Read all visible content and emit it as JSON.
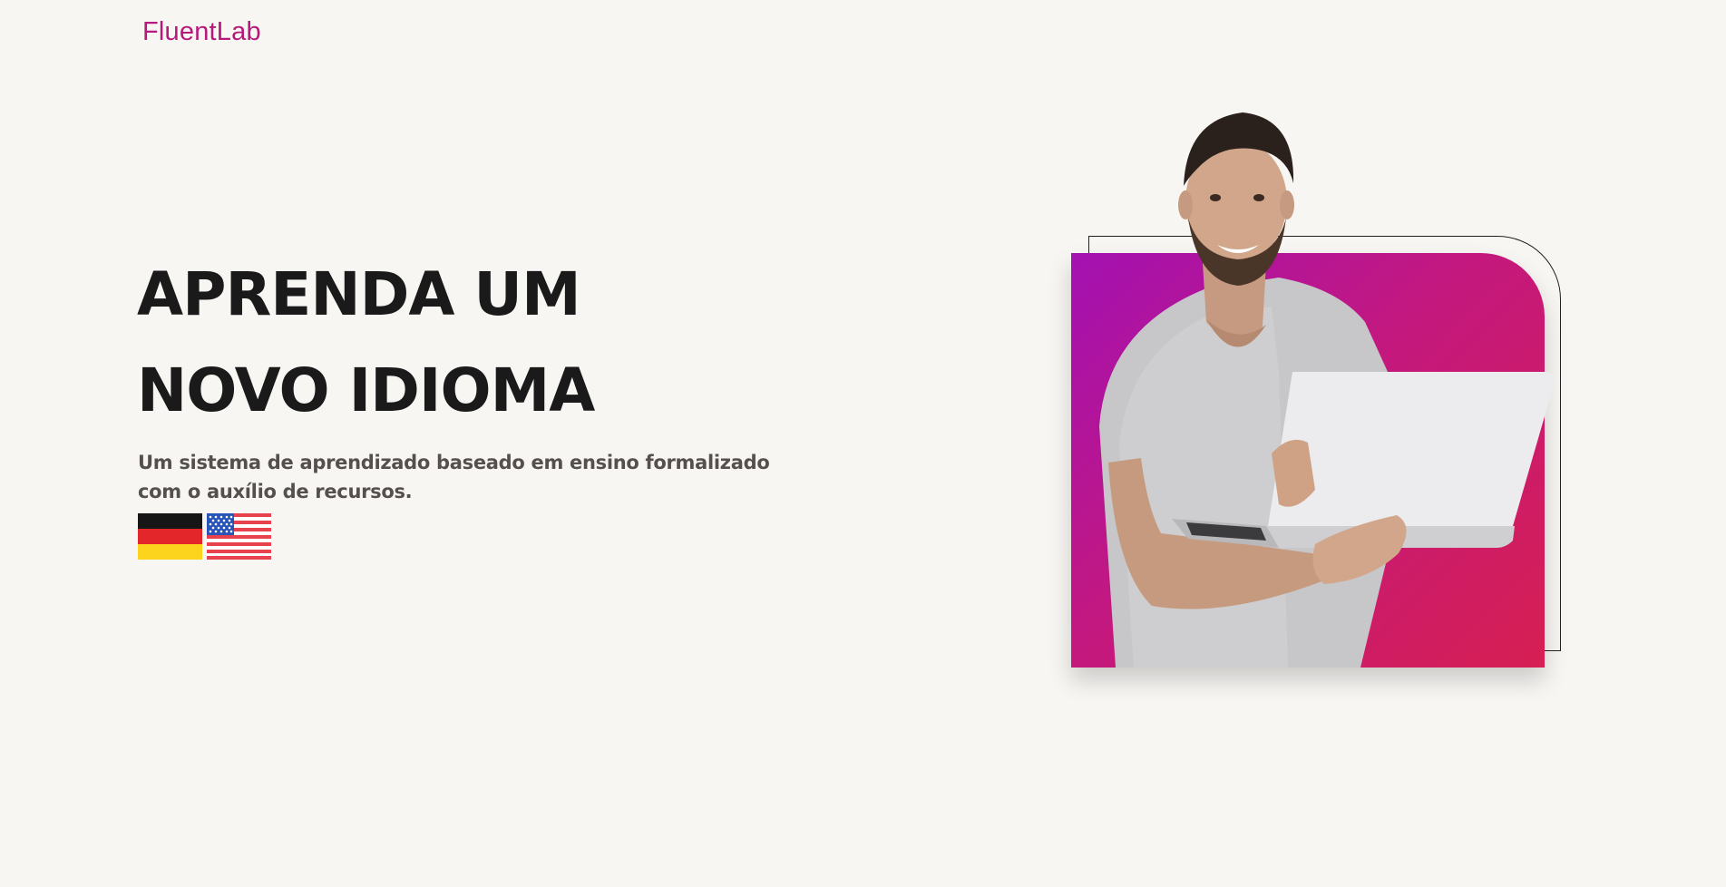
{
  "header": {
    "logo": "FluentLab"
  },
  "hero": {
    "title": "APRENDA UM NOVO IDIOMA",
    "subtitle": "Um sistema de aprendizado baseado em ensino formalizado com o auxílio de recursos."
  },
  "languages": [
    {
      "flag": "germany-flag"
    },
    {
      "flag": "usa-flag"
    }
  ],
  "colors": {
    "background": "#f8f6f3",
    "brand": "#b5197c",
    "title": "#1a1a1a",
    "subtitle": "#55504e",
    "gradient_start": "#a311b2",
    "gradient_end": "#d61f52"
  }
}
